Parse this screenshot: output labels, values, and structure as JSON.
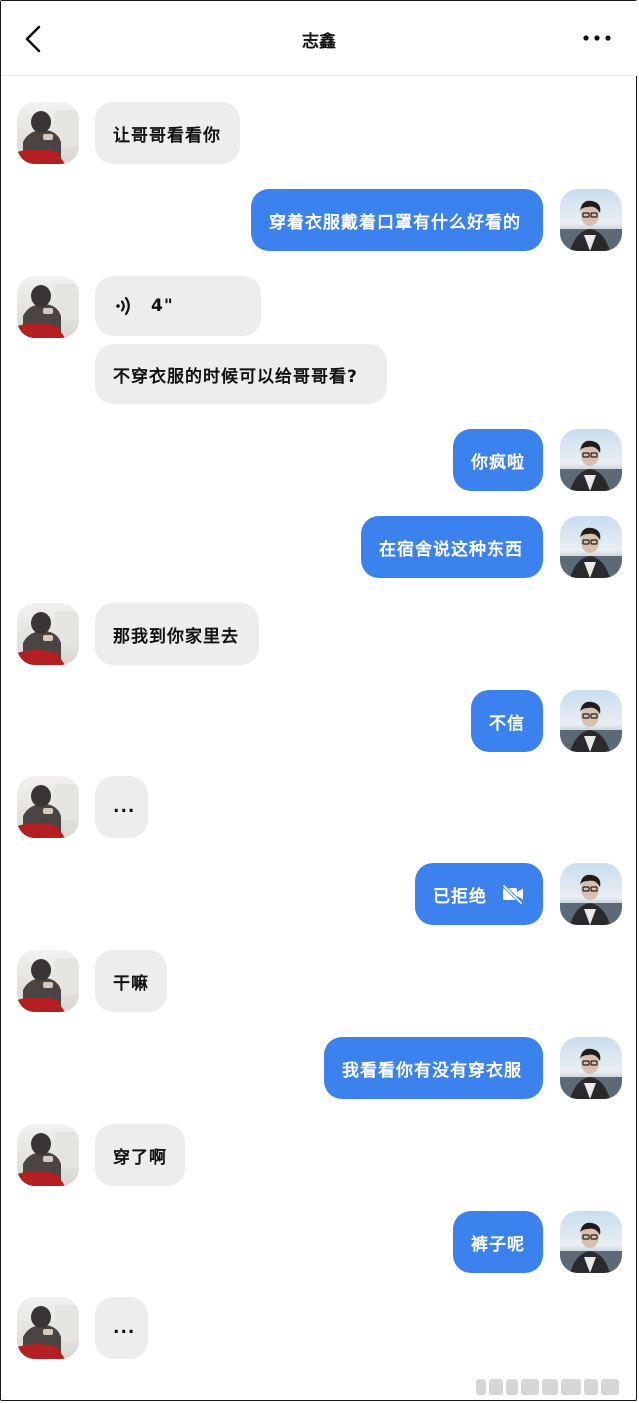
{
  "header": {
    "title": "志鑫",
    "back_icon": "chevron-left-icon",
    "more_icon": "more-horizontal-icon"
  },
  "colors": {
    "outgoing_bubble": "#3b82ee",
    "incoming_bubble": "#ededed",
    "background": "#ffffff"
  },
  "messages": [
    {
      "side": "left",
      "text": "让哥哥看看你"
    },
    {
      "side": "right",
      "text": "穿着衣服戴着口罩有什么好看的"
    },
    {
      "side": "left",
      "voice_duration": "4\"",
      "text": "不穿衣服的时候可以给哥哥看?"
    },
    {
      "side": "right",
      "text": "你疯啦"
    },
    {
      "side": "right",
      "text": "在宿舍说这种东西"
    },
    {
      "side": "left",
      "text": "那我到你家里去"
    },
    {
      "side": "right",
      "text": "不信"
    },
    {
      "side": "left",
      "text": "..."
    },
    {
      "side": "right",
      "text": "已拒绝",
      "icon": "video-off-icon"
    },
    {
      "side": "left",
      "text": "干嘛"
    },
    {
      "side": "right",
      "text": "我看看你有没有穿衣服"
    },
    {
      "side": "left",
      "text": "穿了啊"
    },
    {
      "side": "right",
      "text": "裤子呢"
    },
    {
      "side": "left",
      "text": "..."
    }
  ]
}
